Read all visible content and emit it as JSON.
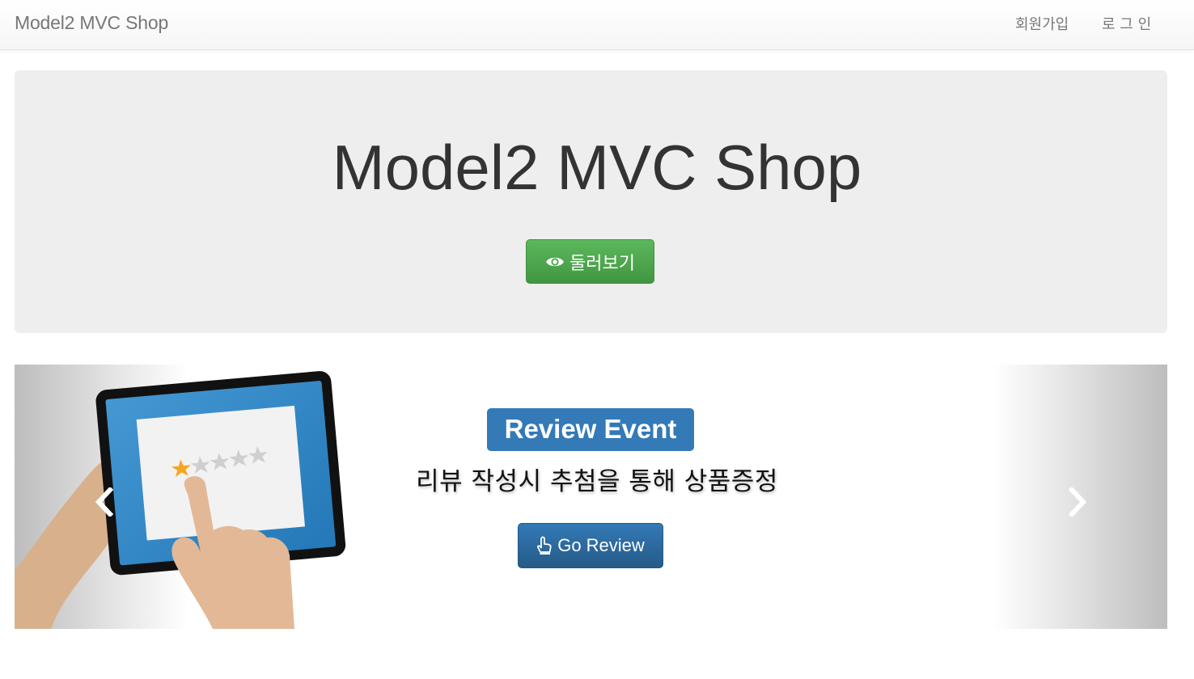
{
  "navbar": {
    "brand": "Model2 MVC Shop",
    "links": [
      {
        "label": "회원가입"
      },
      {
        "label": "로 그 인"
      }
    ]
  },
  "jumbotron": {
    "title": "Model2 MVC Shop",
    "browse_button": {
      "label": "둘러보기",
      "icon": "eye-icon"
    }
  },
  "carousel": {
    "slide": {
      "badge": "Review Event",
      "caption": "리뷰 작성시 추첨을 통해 상품증정",
      "button": {
        "label": "Go Review",
        "icon": "hand-pointer-icon"
      },
      "image": "tablet-rating-illustration",
      "rating_stars": 1,
      "rating_max": 5
    },
    "controls": {
      "prev_icon": "chevron-left-icon",
      "next_icon": "chevron-right-icon"
    }
  },
  "colors": {
    "navbar_text": "#777777",
    "jumbotron_bg": "#eeeeee",
    "success": "#5cb85c",
    "primary": "#337ab7",
    "star_active": "#f5a623",
    "star_inactive": "#cfcfcf"
  }
}
